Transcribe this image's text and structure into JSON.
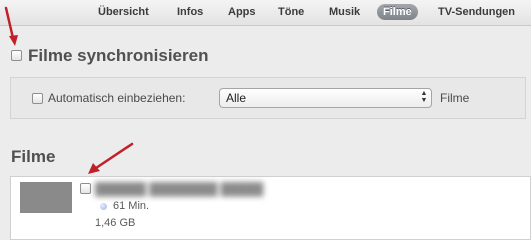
{
  "tabs": [
    {
      "label": "Übersicht",
      "active": false
    },
    {
      "label": "Infos",
      "active": false
    },
    {
      "label": "Apps",
      "active": false
    },
    {
      "label": "Töne",
      "active": false
    },
    {
      "label": "Musik",
      "active": false
    },
    {
      "label": "Filme",
      "active": true
    },
    {
      "label": "TV-Sendungen",
      "active": false
    }
  ],
  "sync": {
    "checkbox_label": "Filme synchronisieren",
    "checked": false
  },
  "auto_include": {
    "checkbox_label": "Automatisch einbeziehen:",
    "checked": false,
    "select_value": "Alle",
    "suffix": "Filme"
  },
  "movies_section": {
    "title": "Filme",
    "items": [
      {
        "title": "██████ ████████ █████",
        "checked": false,
        "duration": "61 Min.",
        "size": "1,46 GB"
      }
    ]
  },
  "colors": {
    "accent_arrow": "#c0202a",
    "active_tab": "#8a8f96"
  }
}
